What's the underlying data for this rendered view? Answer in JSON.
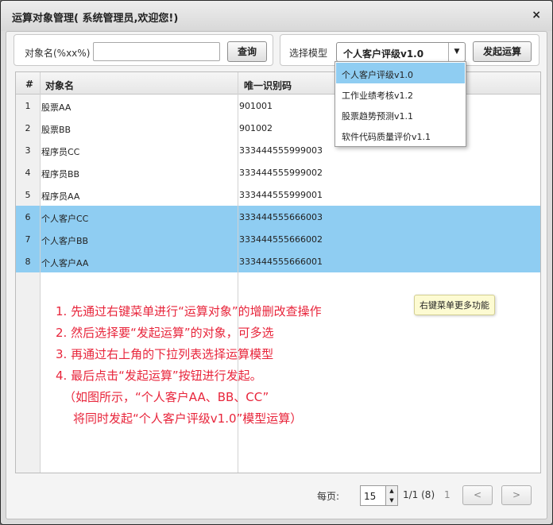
{
  "window": {
    "title": "运算对象管理( 系统管理员,欢迎您!)",
    "close_icon": "×"
  },
  "search": {
    "label": "对象名(%xx%)",
    "value": "",
    "placeholder": "",
    "query_button": "查询"
  },
  "model": {
    "label": "选择模型",
    "selected": "个人客户评级v1.0",
    "submit_button": "发起运算",
    "options": [
      "个人客户评级v1.0",
      "工作业绩考核v1.2",
      "股票趋势预测v1.1",
      "软件代码质量评价v1.1"
    ]
  },
  "grid": {
    "headers": {
      "num": "#",
      "name": "对象名",
      "id": "唯一识别码"
    },
    "rows": [
      {
        "num": "1",
        "name": "股票AA",
        "id": "901001",
        "selected": false
      },
      {
        "num": "2",
        "name": "股票BB",
        "id": "901002",
        "selected": false
      },
      {
        "num": "3",
        "name": "程序员CC",
        "id": "333444555999003",
        "selected": false
      },
      {
        "num": "4",
        "name": "程序员BB",
        "id": "333444555999002",
        "selected": false
      },
      {
        "num": "5",
        "name": "程序员AA",
        "id": "333444555999001",
        "selected": false
      },
      {
        "num": "6",
        "name": "个人客户CC",
        "id": "333444555666003",
        "selected": true
      },
      {
        "num": "7",
        "name": "个人客户BB",
        "id": "333444555666002",
        "selected": true
      },
      {
        "num": "8",
        "name": "个人客户AA",
        "id": "333444555666001",
        "selected": true
      }
    ]
  },
  "tooltip": "右键菜单更多功能",
  "instructions": [
    "1. 先通过右键菜单进行“运算对象”的增删改查操作",
    "2. 然后选择要“发起运算”的对象，可多选",
    "3. 再通过右上角的下拉列表选择运算模型",
    "4. 最后点击“发起运算”按钮进行发起。",
    "（如图所示，“个人客户AA、BB、CC”",
    "将同时发起“个人客户评级v1.0”模型运算）"
  ],
  "pager": {
    "per_page_label": "每页:",
    "per_page": "15",
    "page_info": "1/1 (8)",
    "current_page": "1",
    "prev": "<",
    "next": ">"
  }
}
